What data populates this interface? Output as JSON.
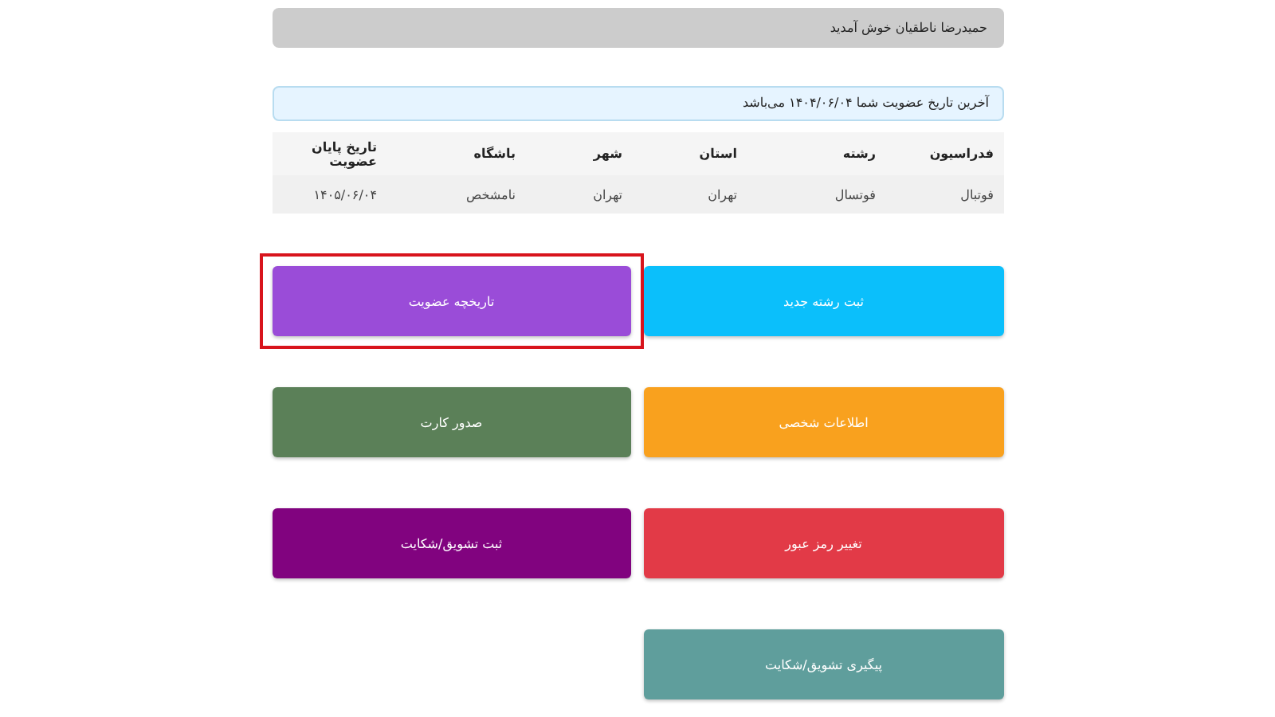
{
  "welcome": "حمیدرضا ناطقیان خوش آمدید",
  "alert": "آخرین تاریخ عضویت شما ۱۴۰۴/۰۶/۰۴ می‌باشد",
  "table": {
    "columns": [
      "فدراسیون",
      "رشته",
      "استان",
      "شهر",
      "باشگاه",
      "تاریخ پایان عضویت"
    ],
    "rows": [
      [
        "فوتبال",
        "فوتسال",
        "تهران",
        "تهران",
        "نامشخص",
        "۱۴۰۵/۰۶/۰۴"
      ]
    ]
  },
  "buttons": [
    {
      "label": "ثبت رشته جدید",
      "color": "#0bbffb",
      "highlighted": false
    },
    {
      "label": "تاریخچه عضویت",
      "color": "#9a4cd8",
      "highlighted": true
    },
    {
      "label": "اطلاعات شخصی",
      "color": "#f9a11e",
      "highlighted": false
    },
    {
      "label": "صدور کارت",
      "color": "#5b8058",
      "highlighted": false
    },
    {
      "label": "تغییر رمز عبور",
      "color": "#e23a47",
      "highlighted": false
    },
    {
      "label": "ثبت تشویق/شکایت",
      "color": "#81037f",
      "highlighted": false
    },
    {
      "label": "پیگیری تشویق/شکایت",
      "color": "#5f9e9c",
      "highlighted": false
    }
  ]
}
